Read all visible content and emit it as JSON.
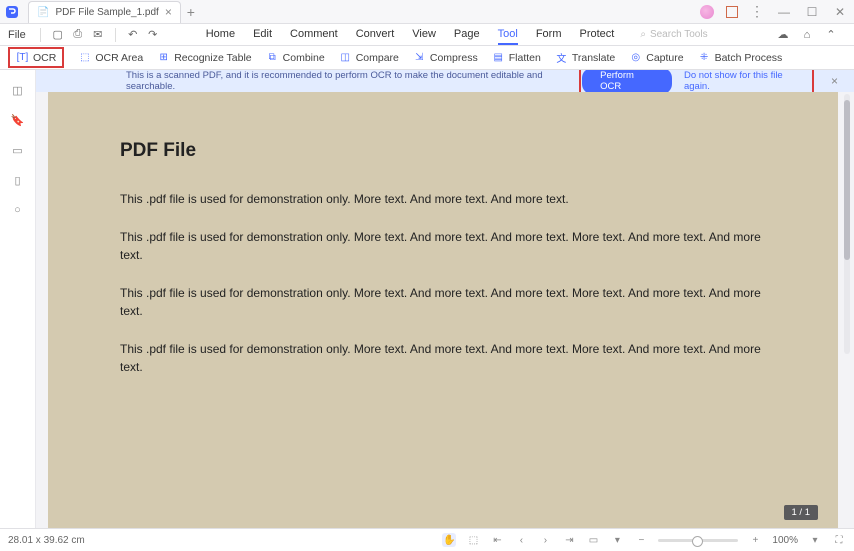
{
  "tab": {
    "title": "PDF File Sample_1.pdf"
  },
  "menus": {
    "file": "File",
    "home": "Home",
    "edit": "Edit",
    "comment": "Comment",
    "convert": "Convert",
    "view": "View",
    "page": "Page",
    "tool": "Tool",
    "form": "Form",
    "protect": "Protect"
  },
  "search_placeholder": "Search Tools",
  "tools": {
    "ocr": "OCR",
    "ocr_area": "OCR Area",
    "recognize_table": "Recognize Table",
    "combine": "Combine",
    "compare": "Compare",
    "compress": "Compress",
    "flatten": "Flatten",
    "translate": "Translate",
    "capture": "Capture",
    "batch": "Batch Process"
  },
  "banner": {
    "text": "This is a scanned PDF, and it is recommended to perform OCR to make the document editable and searchable.",
    "perform": "Perform OCR",
    "dismiss": "Do not show for this file again."
  },
  "ocr_pill": "OCR",
  "doc": {
    "title": "PDF File",
    "p1": "This .pdf file is used for demonstration only. More text. And more text. And more text.",
    "p2": "This .pdf file is used for demonstration only. More text. And more text. And more text. More text. And more text. And more text.",
    "p3": "This .pdf file is used for demonstration only. More text. And more text. And more text. More text. And more text. And more text.",
    "p4": "This .pdf file is used for demonstration only. More text. And more text. And more text. More text. And more text. And more text."
  },
  "page_counter": "1 / 1",
  "status": {
    "dimensions": "28.01 x 39.62 cm",
    "zoom": "100%"
  }
}
